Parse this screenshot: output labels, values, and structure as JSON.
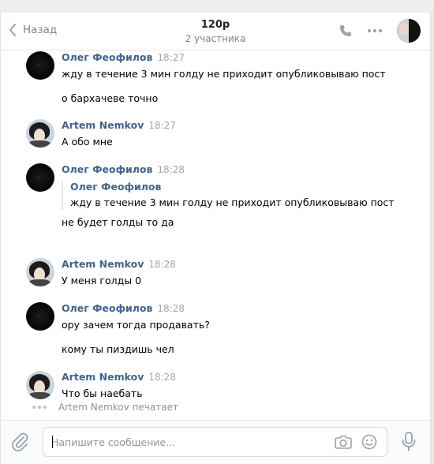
{
  "header": {
    "back_label": "Назад",
    "title": "120р",
    "subtitle": "2 участника"
  },
  "messages": [
    {
      "author": "Олег Феофилов",
      "time": "18:27",
      "avatar": "oleg",
      "lines": [
        "жду в течение 3 мин голду не приходит опубликовываю пост",
        "о бархачеве точно"
      ]
    },
    {
      "author": "Artem Nemkov",
      "time": "18:27",
      "avatar": "artem",
      "lines": [
        "А обо мне"
      ]
    },
    {
      "author": "Олег Феофилов",
      "time": "18:28",
      "avatar": "oleg",
      "forwarded": {
        "author": "Олег Феофилов",
        "text": "жду в течение 3 мин голду не приходит опубликовываю пост"
      },
      "lines": [
        "не будет голды то да"
      ]
    },
    {
      "author": "Artem Nemkov",
      "time": "18:28",
      "avatar": "artem",
      "lines": [
        "У меня голды 0"
      ]
    },
    {
      "author": "Олег Феофилов",
      "time": "18:28",
      "avatar": "oleg",
      "lines": [
        "ору зачем тогда продавать?",
        "кому ты пиздишь чел"
      ]
    },
    {
      "author": "Artem Nemkov",
      "time": "18:28",
      "avatar": "artem",
      "lines": [
        "Что бы наебать"
      ]
    }
  ],
  "typing": {
    "text": "Artem Nemkov печатает"
  },
  "composer": {
    "placeholder": "Напишите сообщение...",
    "value": ""
  },
  "icons": {
    "back": "chevron-left-icon",
    "call": "phone-icon",
    "more": "more-dots-icon",
    "attach": "paperclip-icon",
    "camera": "camera-icon",
    "emoji": "smiley-icon",
    "mic": "microphone-icon"
  },
  "colors": {
    "name_link": "#42648b",
    "muted": "#828282",
    "time": "#a0a6ad"
  }
}
